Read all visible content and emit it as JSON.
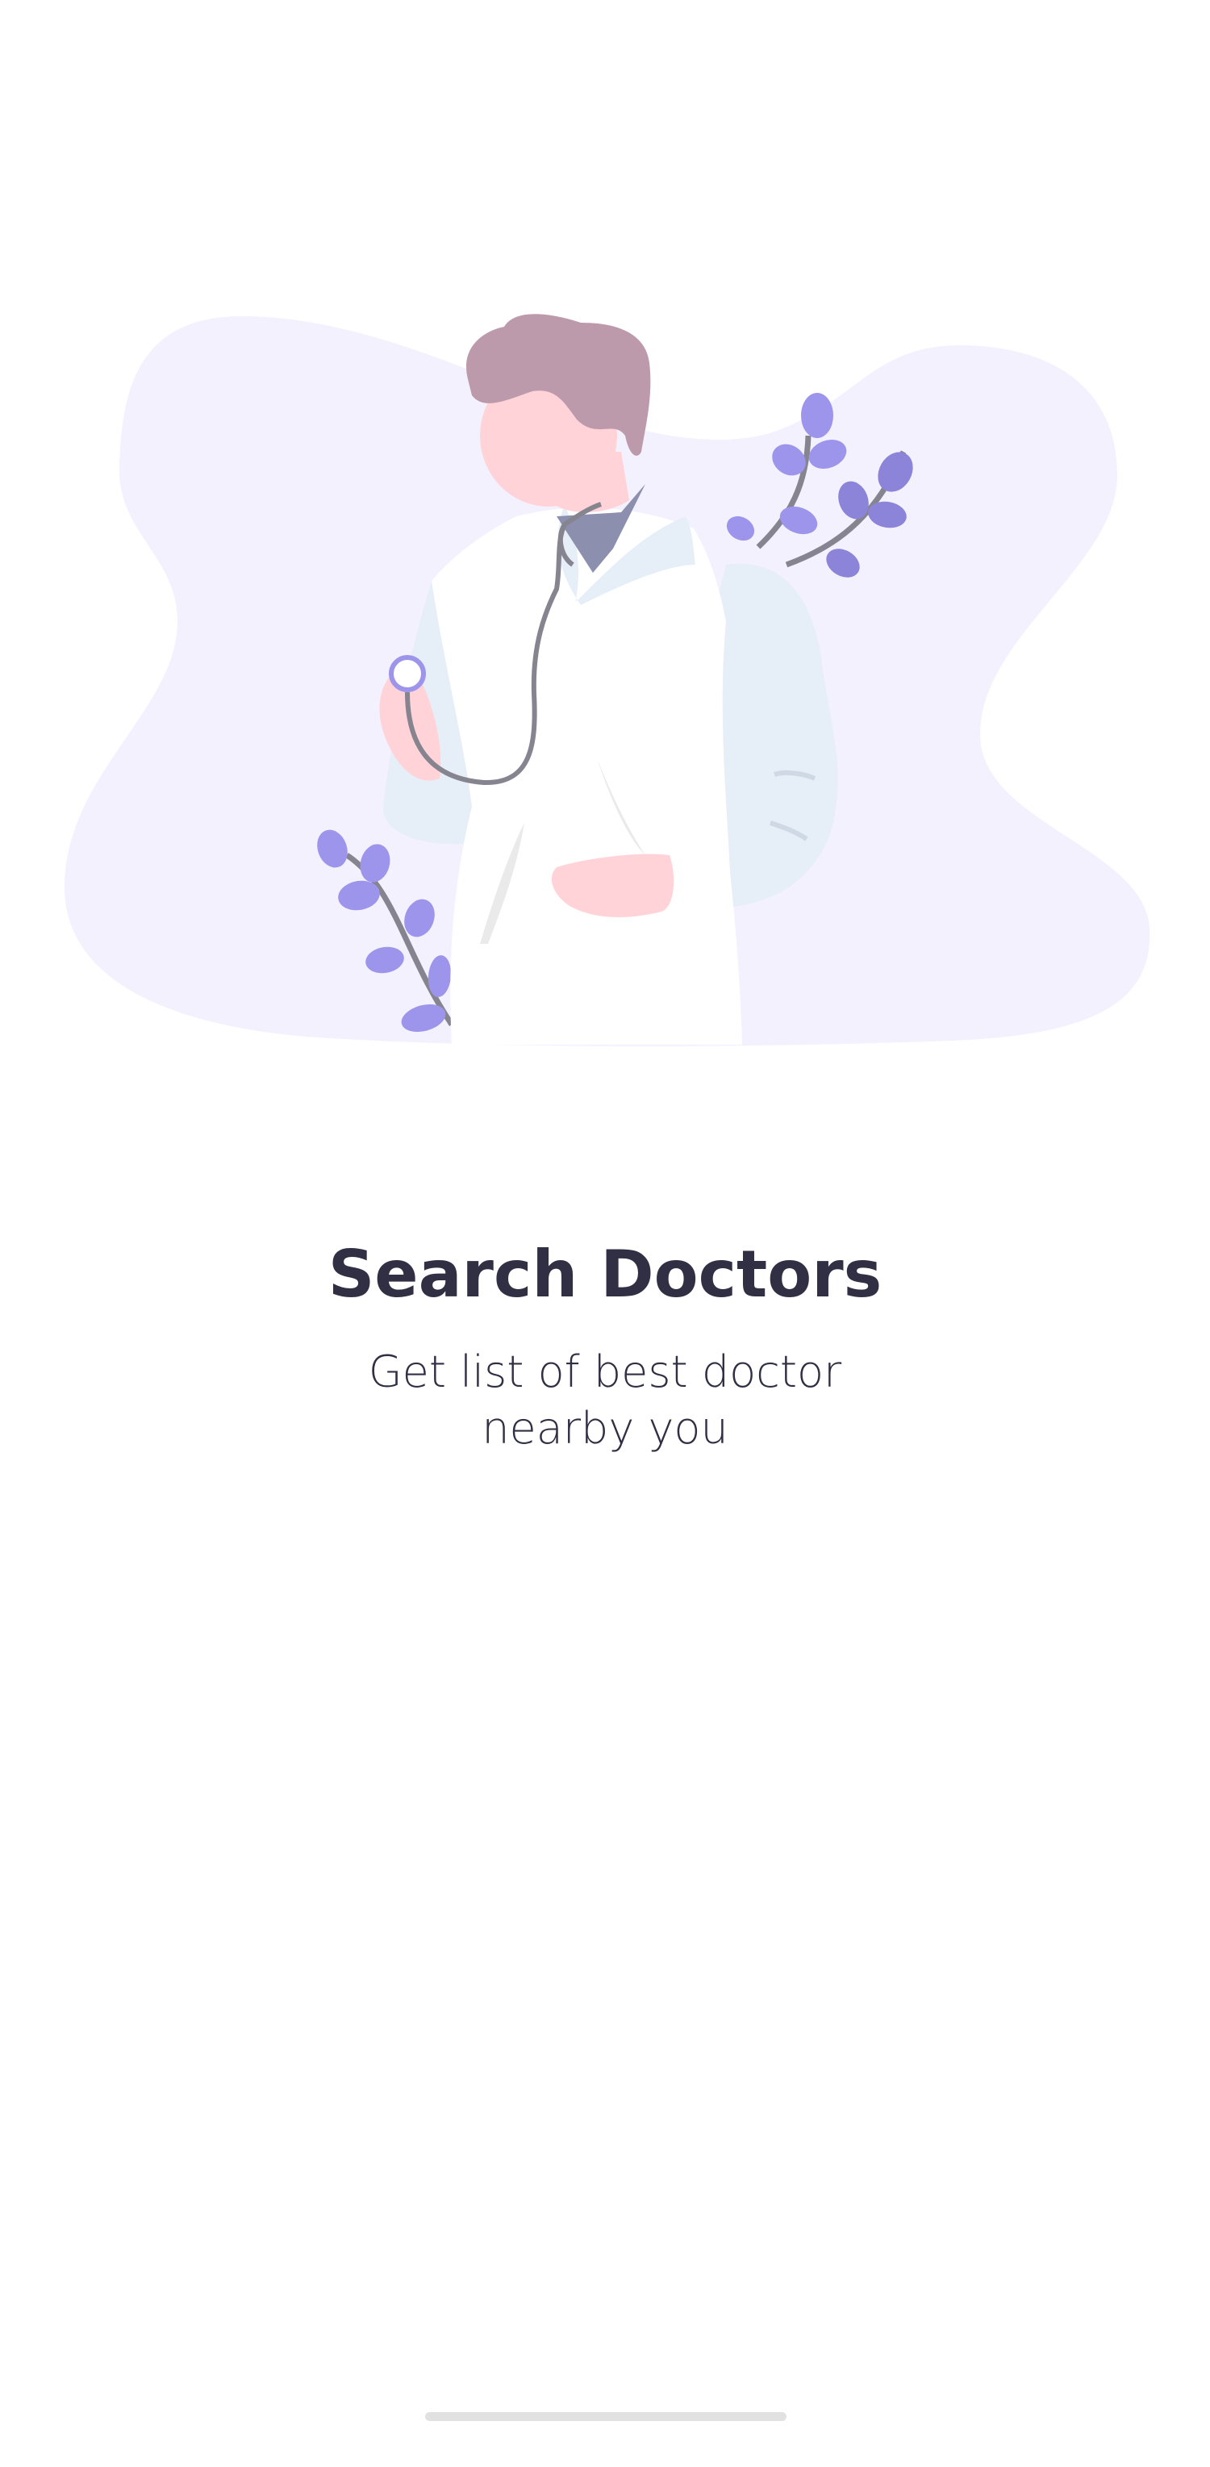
{
  "onboarding": {
    "title": "Search Doctors",
    "subtitle": "Get list of best doctor nearby you"
  },
  "illustration": {
    "icon": "doctor-with-stethoscope-illustration",
    "colors": {
      "blob": "#f3f1fd",
      "leaf": "#9d94ec",
      "leaf_dark": "#8b84d9",
      "stem": "#86848f",
      "skin": "#ffd3d8",
      "hair": "#bd9aab",
      "coat": "#ffffff",
      "coat_shadow": "#e6eef7",
      "tie": "#8d8fae"
    }
  },
  "colors": {
    "text": "#302f44",
    "background": "#ffffff",
    "home_indicator": "#e1e1e1"
  }
}
